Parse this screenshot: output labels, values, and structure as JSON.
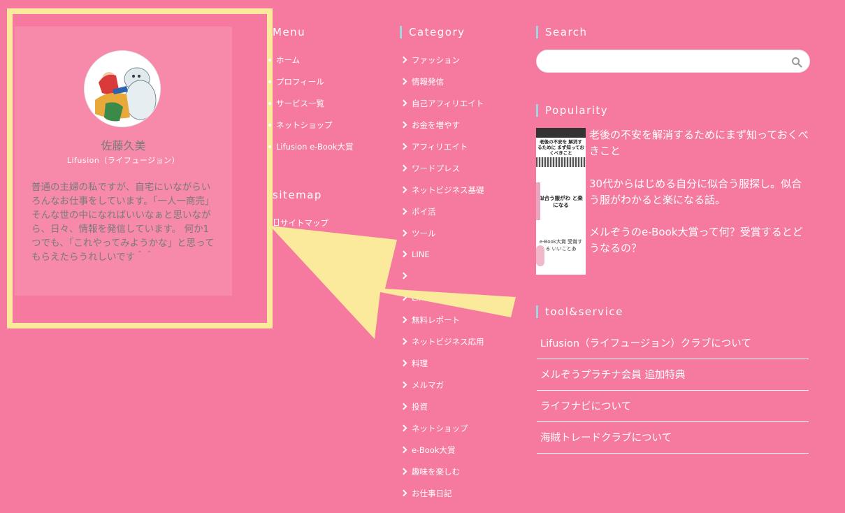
{
  "profile": {
    "name": "佐藤久美",
    "subtitle": "Lifusion（ライフュージョン）",
    "bio": "普通の主婦の私ですが、自宅にいながらいろんなお仕事をしています。「一人一商売」そんな世の中になればいいなぁと思いながら、日々、情報を発信しています。 何か1つでも、「これやってみようかな」と思ってもらえたらうれしいです＾＾"
  },
  "menu": {
    "title": "Menu",
    "items": [
      "ホーム",
      "プロフィール",
      "サービス一覧",
      "ネットショップ",
      "Lifusion e-Book大賞"
    ]
  },
  "sitemap": {
    "title": "sitemap",
    "items": [
      "サイトマップ"
    ]
  },
  "category": {
    "title": "Category",
    "items": [
      "ファッション",
      "情報発信",
      "自己アフィリエイト",
      "お金を増やす",
      "アフィリエイト",
      "ワードプレス",
      "ネットビジネス基礎",
      "ポイ活",
      "ツール",
      "LINE",
      "",
      "Lifusion e",
      "無料レポート",
      "ネットビジネス応用",
      "料理",
      "メルマガ",
      "投資",
      "ネットショップ",
      "e-Book大賞",
      "趣味を楽しむ",
      "お仕事日記"
    ]
  },
  "search": {
    "title": "Search",
    "value": ""
  },
  "popularity": {
    "title": "Popularity",
    "items": [
      {
        "title": "老後の不安を解消するためにまず知っておくべきこと",
        "thumb_text": "老後の不安を 解消するために まず知っておくべきこと"
      },
      {
        "title": "30代からはじめる自分に似合う服探し。似合う服がわかると楽になる話。",
        "thumb_text": "似合う服がわ と楽になる"
      },
      {
        "title": "メルぞうのe-Book大賞って何？受賞するとどうなるの？",
        "thumb_text": "e-Book大賞 受賞する いいことあ"
      }
    ]
  },
  "tool_service": {
    "title": "tool&service",
    "items": [
      "Lifusion（ライフュージョン）クラブについて",
      "メルぞうプラチナ会員 追加特典",
      "ライフナビについて",
      "海賊トレードクラブについて"
    ]
  },
  "colors": {
    "background": "#f67a9f",
    "highlight": "#fbe99c",
    "heading_bar": "#9fd7e0"
  }
}
